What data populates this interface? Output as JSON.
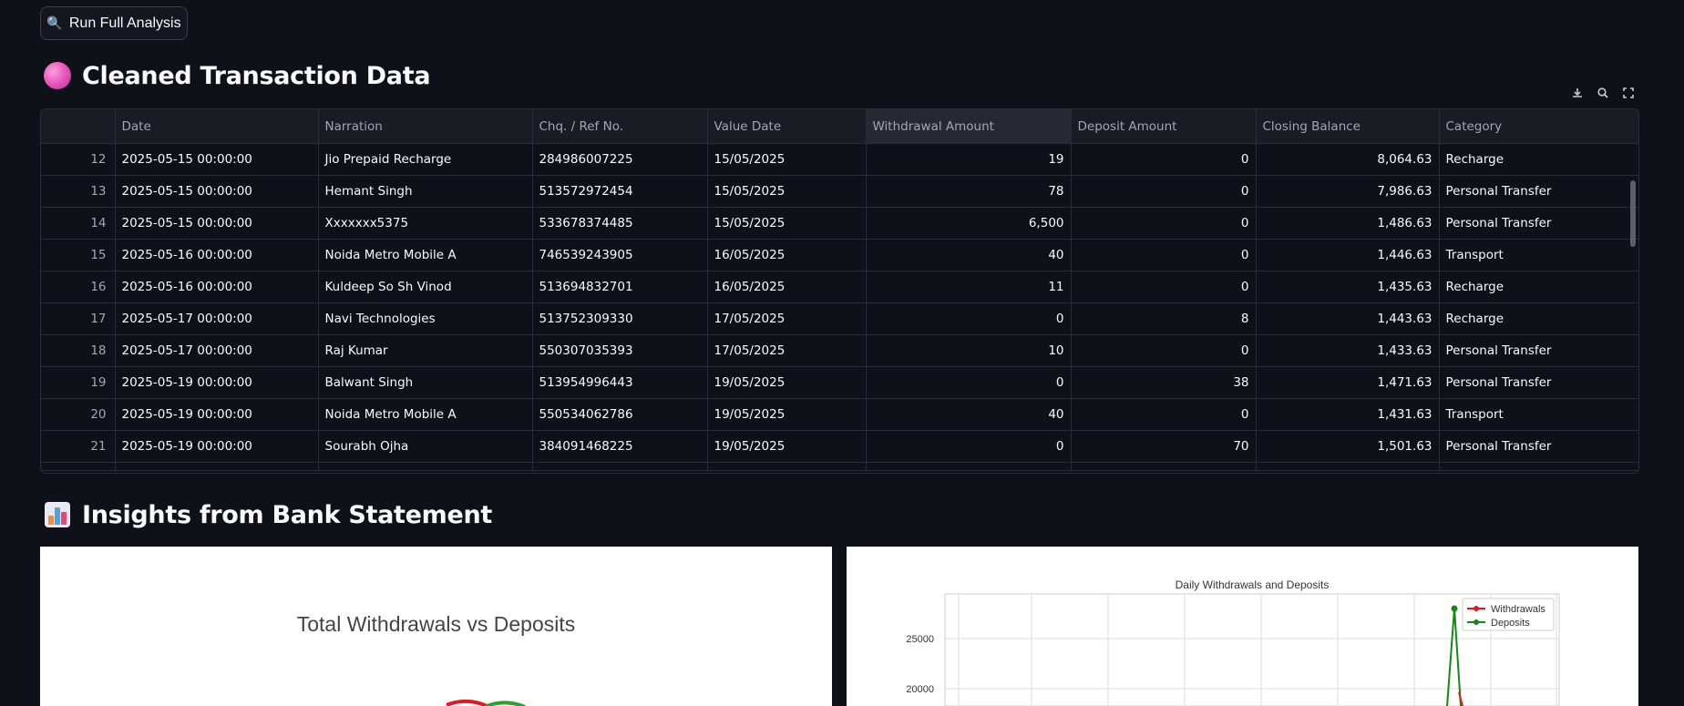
{
  "toolbar": {
    "run_button_label": "Run Full Analysis"
  },
  "section_cleaned": {
    "title": "Cleaned Transaction Data"
  },
  "section_insights": {
    "title": "Insights from Bank Statement"
  },
  "table": {
    "columns": [
      "",
      "Date",
      "Narration",
      "Chq. / Ref No.",
      "Value Date",
      "Withdrawal Amount",
      "Deposit Amount",
      "Closing Balance",
      "Category"
    ],
    "rows": [
      [
        "12",
        "2025-05-15 00:00:00",
        "Jio Prepaid Recharge",
        "284986007225",
        "15/05/2025",
        "19",
        "0",
        "8,064.63",
        "Recharge"
      ],
      [
        "13",
        "2025-05-15 00:00:00",
        "Hemant Singh",
        "513572972454",
        "15/05/2025",
        "78",
        "0",
        "7,986.63",
        "Personal Transfer"
      ],
      [
        "14",
        "2025-05-15 00:00:00",
        "Xxxxxxx5375",
        "533678374485",
        "15/05/2025",
        "6,500",
        "0",
        "1,486.63",
        "Personal Transfer"
      ],
      [
        "15",
        "2025-05-16 00:00:00",
        "Noida Metro Mobile A",
        "746539243905",
        "16/05/2025",
        "40",
        "0",
        "1,446.63",
        "Transport"
      ],
      [
        "16",
        "2025-05-16 00:00:00",
        "Kuldeep So Sh Vinod",
        "513694832701",
        "16/05/2025",
        "11",
        "0",
        "1,435.63",
        "Recharge"
      ],
      [
        "17",
        "2025-05-17 00:00:00",
        "Navi Technologies",
        "513752309330",
        "17/05/2025",
        "0",
        "8",
        "1,443.63",
        "Recharge"
      ],
      [
        "18",
        "2025-05-17 00:00:00",
        "Raj Kumar",
        "550307035393",
        "17/05/2025",
        "10",
        "0",
        "1,433.63",
        "Personal Transfer"
      ],
      [
        "19",
        "2025-05-19 00:00:00",
        "Balwant Singh",
        "513954996443",
        "19/05/2025",
        "0",
        "38",
        "1,471.63",
        "Personal Transfer"
      ],
      [
        "20",
        "2025-05-19 00:00:00",
        "Noida Metro Mobile A",
        "550534062786",
        "19/05/2025",
        "40",
        "0",
        "1,431.63",
        "Transport"
      ],
      [
        "21",
        "2025-05-19 00:00:00",
        "Sourabh Ojha",
        "384091468225",
        "19/05/2025",
        "0",
        "70",
        "1,501.63",
        "Personal Transfer"
      ]
    ]
  },
  "pie_chart": {
    "title": "Total Withdrawals vs Deposits",
    "colors": {
      "withdrawals": "#e31a1c",
      "deposits": "#2ca02c"
    }
  },
  "chart_data": {
    "type": "line",
    "title": "Daily Withdrawals and Deposits",
    "xlabel": "",
    "ylabel": "",
    "yticks_visible": [
      20000,
      25000
    ],
    "legend_position": "top-right",
    "grid": true,
    "series": [
      {
        "name": "Withdrawals",
        "color": "#e31a1c"
      },
      {
        "name": "Deposits",
        "color": "#138a13",
        "visible_peak": 28000
      }
    ]
  }
}
